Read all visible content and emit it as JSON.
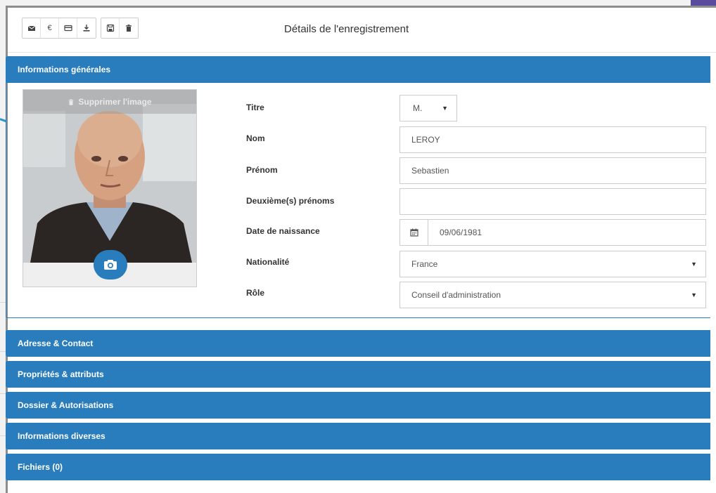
{
  "modal": {
    "title": "Détails de l'enregistrement",
    "toolbar": {
      "group1": [
        {
          "icon": "envelope-icon",
          "label": "✉"
        },
        {
          "icon": "euro-icon",
          "label": "€"
        },
        {
          "icon": "credit-card-icon",
          "label": ""
        },
        {
          "icon": "download-icon",
          "label": ""
        }
      ],
      "group2": [
        {
          "icon": "save-icon",
          "label": ""
        },
        {
          "icon": "trash-icon",
          "label": ""
        }
      ]
    }
  },
  "general": {
    "heading": "Informations générales",
    "photo": {
      "remove_label": "Supprimer l'image"
    },
    "fields": {
      "titre": {
        "label": "Titre",
        "value": "M."
      },
      "nom": {
        "label": "Nom",
        "value": "LEROY"
      },
      "prenom": {
        "label": "Prénom",
        "value": "Sebastien"
      },
      "deuxieme": {
        "label": "Deuxième(s) prénoms",
        "value": ""
      },
      "naissance": {
        "label": "Date de naissance",
        "value": "09/06/1981"
      },
      "nationalite": {
        "label": "Nationalité",
        "value": "France"
      },
      "role": {
        "label": "Rôle",
        "value": "Conseil d'administration"
      }
    }
  },
  "sections": [
    {
      "label": "Adresse & Contact"
    },
    {
      "label": "Propriétés & attributs"
    },
    {
      "label": "Dossier & Autorisations"
    },
    {
      "label": "Informations diverses"
    },
    {
      "label": "Fichiers (0)"
    }
  ],
  "colors": {
    "accent": "#2a7dbd",
    "border": "#cccccc"
  }
}
